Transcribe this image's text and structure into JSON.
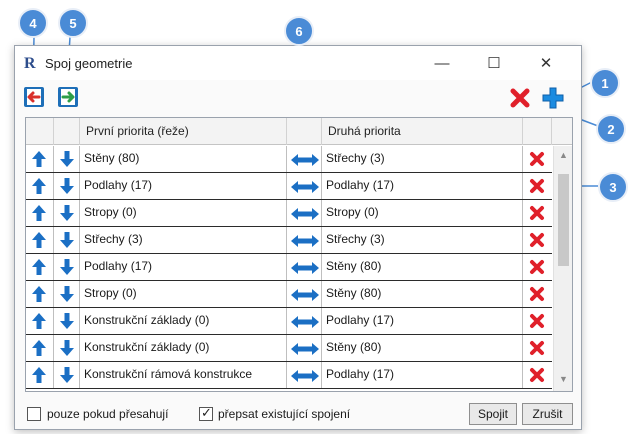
{
  "window": {
    "title": "Spoj geometrie",
    "app_letter": "R",
    "minimize": "—",
    "maximize": "☐",
    "close": "✕"
  },
  "grid": {
    "headers": {
      "first": "První priorita (řeže)",
      "second": "Druhá priorita"
    },
    "rows": [
      {
        "first": "Stěny (80)",
        "second": "Střechy (3)"
      },
      {
        "first": "Podlahy (17)",
        "second": "Podlahy (17)"
      },
      {
        "first": "Stropy (0)",
        "second": "Stropy (0)"
      },
      {
        "first": "Střechy (3)",
        "second": "Střechy (3)"
      },
      {
        "first": "Podlahy (17)",
        "second": "Stěny (80)"
      },
      {
        "first": "Stropy (0)",
        "second": "Stěny (80)"
      },
      {
        "first": "Konstrukční základy (0)",
        "second": "Podlahy (17)"
      },
      {
        "first": "Konstrukční základy (0)",
        "second": "Stěny (80)"
      },
      {
        "first": "Konstrukční rámová konstrukce",
        "second": "Podlahy (17)"
      }
    ]
  },
  "footer": {
    "only_overlapping": {
      "label": "pouze pokud přesahují",
      "checked": false
    },
    "overwrite_existing": {
      "label": "přepsat existující spojení",
      "checked": true
    },
    "join_button": "Spojit",
    "cancel_button": "Zrušit"
  },
  "callouts": [
    "1",
    "2",
    "3",
    "4",
    "5",
    "6"
  ],
  "colors": {
    "accent": "#4a8bd6",
    "arrow_blue": "#1b6fc4",
    "delete_red": "#e0202a",
    "import_red": "#d9302b",
    "export_green": "#2e9e48"
  }
}
